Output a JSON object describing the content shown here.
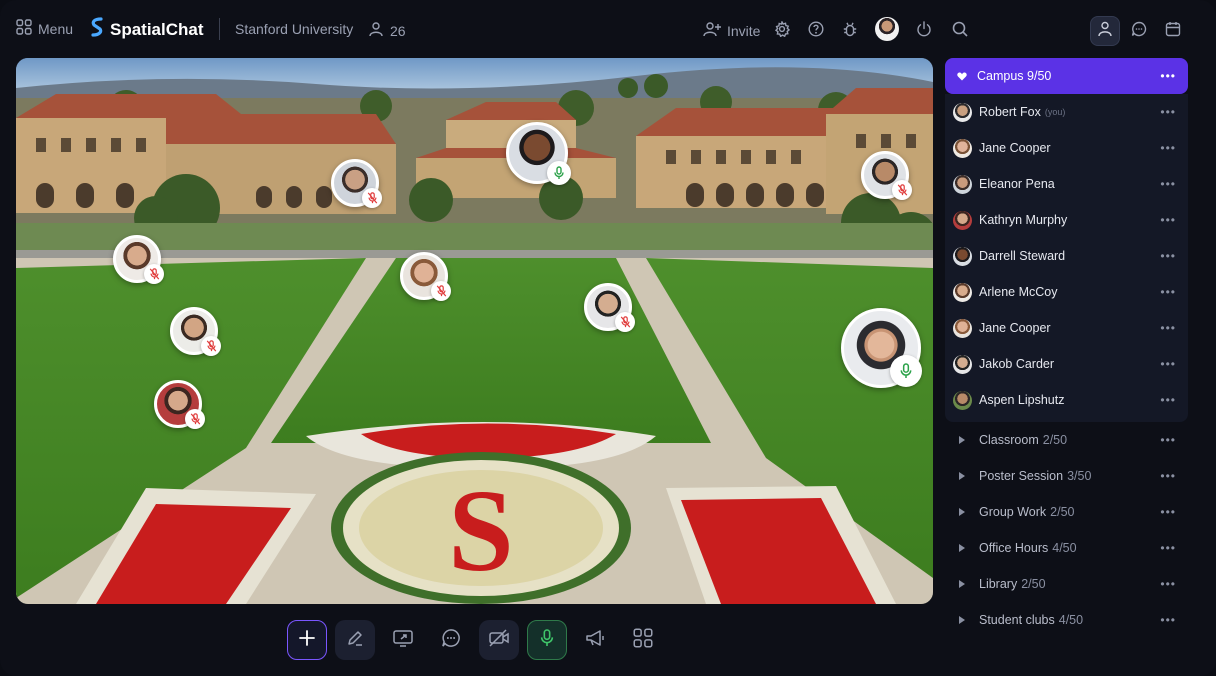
{
  "app": {
    "menu_label": "Menu",
    "brand": "SpatialChat",
    "org": "Stanford University",
    "people_count": "26",
    "invite_label": "Invite",
    "accent": "#5b32e6"
  },
  "topbar_icons": [
    "grid-icon",
    "user-icon",
    "user-plus-icon",
    "gear-icon",
    "help-icon",
    "bug-icon",
    "avatar",
    "power-icon",
    "search-icon",
    "person-icon",
    "chat-icon",
    "calendar-icon"
  ],
  "toolbar": {
    "buttons": [
      "add",
      "pen",
      "screen-share",
      "chat",
      "camera-off",
      "microphone",
      "megaphone",
      "apps"
    ]
  },
  "scene_avatars": [
    {
      "name": "avatar-1",
      "mic": "on"
    },
    {
      "name": "avatar-2",
      "mic": "off"
    },
    {
      "name": "avatar-3",
      "mic": "off"
    },
    {
      "name": "avatar-4",
      "mic": "off"
    },
    {
      "name": "avatar-5",
      "mic": "off"
    },
    {
      "name": "avatar-6",
      "mic": "off"
    },
    {
      "name": "avatar-7",
      "mic": "off"
    },
    {
      "name": "avatar-8",
      "mic": "off"
    },
    {
      "name": "avatar-9",
      "mic": "on"
    }
  ],
  "sidebar": {
    "current_room": {
      "name": "Campus",
      "count": "9/50"
    },
    "members": [
      {
        "name": "Robert Fox",
        "tag": "(you)"
      },
      {
        "name": "Jane Cooper",
        "tag": ""
      },
      {
        "name": "Eleanor Pena",
        "tag": ""
      },
      {
        "name": "Kathryn Murphy",
        "tag": ""
      },
      {
        "name": "Darrell Steward",
        "tag": ""
      },
      {
        "name": "Arlene McCoy",
        "tag": ""
      },
      {
        "name": "Jane Cooper",
        "tag": ""
      },
      {
        "name": "Jakob Carder",
        "tag": ""
      },
      {
        "name": "Aspen Lipshutz",
        "tag": ""
      }
    ],
    "rooms": [
      {
        "name": "Classroom",
        "count": "2/50"
      },
      {
        "name": "Poster Session",
        "count": "3/50"
      },
      {
        "name": "Group Work",
        "count": "2/50"
      },
      {
        "name": "Office Hours",
        "count": "4/50"
      },
      {
        "name": "Library",
        "count": "2/50"
      },
      {
        "name": "Student clubs",
        "count": "4/50"
      }
    ],
    "more_label": "•••"
  }
}
